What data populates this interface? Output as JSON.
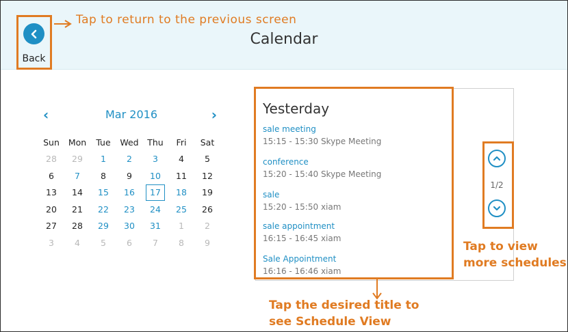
{
  "header": {
    "title": "Calendar",
    "back_label": "Back"
  },
  "annotations": {
    "back_hint": "Tap to return to the previous screen",
    "more_hint_line1": "Tap to view",
    "more_hint_line2": "more schedules",
    "title_hint_line1": "Tap the desired title to",
    "title_hint_line2": "see Schedule View"
  },
  "calendar": {
    "month": "Mar 2016",
    "weekdays": [
      "Sun",
      "Mon",
      "Tue",
      "Wed",
      "Thu",
      "Fri",
      "Sat"
    ],
    "weeks": [
      [
        {
          "d": "28",
          "s": "muted"
        },
        {
          "d": "29",
          "s": "muted"
        },
        {
          "d": "1",
          "s": "blue"
        },
        {
          "d": "2",
          "s": "blue"
        },
        {
          "d": "3",
          "s": "blue"
        },
        {
          "d": "4",
          "s": ""
        },
        {
          "d": "5",
          "s": ""
        }
      ],
      [
        {
          "d": "6",
          "s": ""
        },
        {
          "d": "7",
          "s": "blue"
        },
        {
          "d": "8",
          "s": ""
        },
        {
          "d": "9",
          "s": ""
        },
        {
          "d": "10",
          "s": "blue"
        },
        {
          "d": "11",
          "s": ""
        },
        {
          "d": "12",
          "s": ""
        }
      ],
      [
        {
          "d": "13",
          "s": ""
        },
        {
          "d": "14",
          "s": ""
        },
        {
          "d": "15",
          "s": "blue"
        },
        {
          "d": "16",
          "s": "blue"
        },
        {
          "d": "17",
          "s": "blue today"
        },
        {
          "d": "18",
          "s": "blue"
        },
        {
          "d": "19",
          "s": ""
        }
      ],
      [
        {
          "d": "20",
          "s": ""
        },
        {
          "d": "21",
          "s": ""
        },
        {
          "d": "22",
          "s": "blue"
        },
        {
          "d": "23",
          "s": "blue"
        },
        {
          "d": "24",
          "s": "blue"
        },
        {
          "d": "25",
          "s": "blue"
        },
        {
          "d": "26",
          "s": ""
        }
      ],
      [
        {
          "d": "27",
          "s": ""
        },
        {
          "d": "28",
          "s": ""
        },
        {
          "d": "29",
          "s": "blue"
        },
        {
          "d": "30",
          "s": "blue"
        },
        {
          "d": "31",
          "s": "blue"
        },
        {
          "d": "1",
          "s": "muted"
        },
        {
          "d": "2",
          "s": "muted"
        }
      ],
      [
        {
          "d": "3",
          "s": "muted"
        },
        {
          "d": "4",
          "s": "muted"
        },
        {
          "d": "5",
          "s": "muted"
        },
        {
          "d": "6",
          "s": "muted"
        },
        {
          "d": "7",
          "s": "muted"
        },
        {
          "d": "8",
          "s": "muted"
        },
        {
          "d": "9",
          "s": "muted"
        }
      ]
    ]
  },
  "schedule": {
    "day_title": "Yesterday",
    "items": [
      {
        "name": "sale meeting",
        "time": "15:15 - 15:30 Skype Meeting"
      },
      {
        "name": "conference",
        "time": "15:20 - 15:40 Skype Meeting"
      },
      {
        "name": "sale",
        "time": "15:20 - 15:50 xiam"
      },
      {
        "name": "sale appointment",
        "time": "16:15 - 16:45 xiam"
      },
      {
        "name": "Sale Appointment",
        "time": "16:16 - 16:46 xiam"
      }
    ],
    "page_indicator": "1/2"
  },
  "colors": {
    "accent": "#1f8fc4",
    "annotation": "#e07b22",
    "header_bg": "#eaf6fa"
  },
  "icons": {
    "back": "chevron-left-icon",
    "prev_month": "chevron-left-icon",
    "next_month": "chevron-right-icon",
    "page_up": "chevron-up-icon",
    "page_down": "chevron-down-icon"
  }
}
